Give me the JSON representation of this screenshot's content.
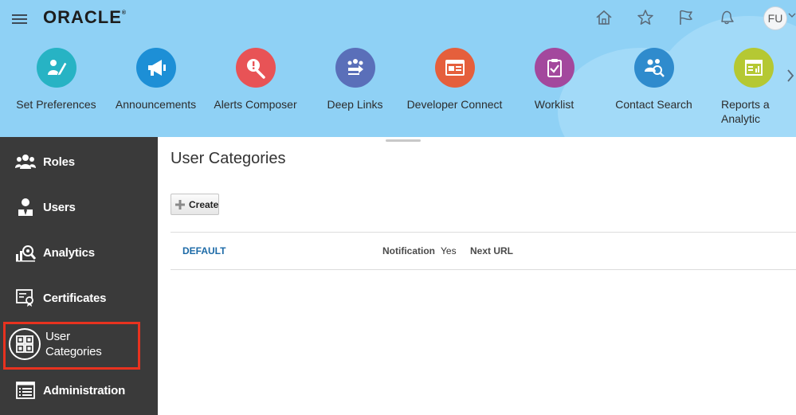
{
  "header": {
    "logo": "ORACLE",
    "logo_mark": "®",
    "user_initials": "FU"
  },
  "apps": [
    {
      "label": "Set Preferences",
      "icon": "set-preferences-icon",
      "color": "#27b3c4"
    },
    {
      "label": "Announcements",
      "icon": "megaphone-icon",
      "color": "#1d8fd6"
    },
    {
      "label": "Alerts Composer",
      "icon": "alert-wrench-icon",
      "color": "#e85356"
    },
    {
      "label": "Deep Links",
      "icon": "deep-links-icon",
      "color": "#5a6fb9"
    },
    {
      "label": "Developer Connect",
      "icon": "developer-connect-icon",
      "color": "#e55f3c"
    },
    {
      "label": "Worklist",
      "icon": "clipboard-check-icon",
      "color": "#a3489d"
    },
    {
      "label": "Contact Search",
      "icon": "contact-search-icon",
      "color": "#2f8bcd"
    },
    {
      "label": "Reports a Analytic",
      "icon": "reports-icon",
      "color": "#b5c833"
    }
  ],
  "sidebar": {
    "items": [
      {
        "label": "Roles",
        "icon": "roles-icon"
      },
      {
        "label": "Users",
        "icon": "users-icon"
      },
      {
        "label": "Analytics",
        "icon": "analytics-icon"
      },
      {
        "label": "Certificates",
        "icon": "certificates-icon"
      },
      {
        "label_line1": "User",
        "label_line2": "Categories",
        "icon": "user-categories-icon",
        "selected": true
      },
      {
        "label": "Administration",
        "icon": "administration-icon"
      }
    ]
  },
  "main": {
    "title": "User Categories",
    "create_label": "Create",
    "rows": [
      {
        "name": "DEFAULT",
        "notification_label": "Notification",
        "notification_value": "Yes",
        "next_url_label": "Next URL"
      }
    ]
  },
  "colors": {
    "header_bg": "#8fd1f5",
    "sidebar_bg": "#3a3a3a",
    "link": "#1c6aa7",
    "highlight_box": "#e8321f"
  }
}
